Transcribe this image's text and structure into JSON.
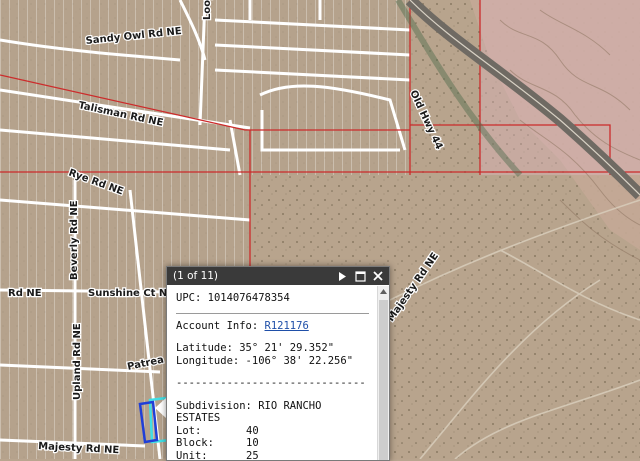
{
  "map": {
    "street_labels": [
      "Sandy Owl Rd NE",
      "Talisman Rd NE",
      "Rye Rd NE",
      "Beverly Rd NE",
      "Rd NE",
      "Sunshine Ct NE",
      "Upland Rd NE",
      "Patrea",
      "Majesty Rd NE",
      "Majesty Rd NE",
      "Old Hwy 44",
      "Loop Rd NE"
    ],
    "colors": {
      "imagery": "#b9a58f",
      "parcel_lines": "#ffffff",
      "district_lines": "#cc2b2b",
      "highway": "#6f6a63",
      "selected_parcel": "#1f3fd8",
      "highlight": "#3fe0e6"
    }
  },
  "popup": {
    "pager": "(1 of 11)",
    "next_icon": "play-icon",
    "maximize_icon": "maximize-icon",
    "close_icon": "close-icon",
    "upc_label": "UPC:",
    "upc_value": "1014076478354",
    "account_label": "Account Info:",
    "account_value": "R121176",
    "latitude_label": "Latitude:",
    "latitude_value": "35° 21' 29.352\"",
    "longitude_label": "Longitude:",
    "longitude_value": "-106° 38' 22.256\"",
    "divider_text": "------------------------------",
    "subdivision_label": "Subdivision:",
    "subdivision_value": "RIO RANCHO ESTATES",
    "lot_label": "Lot:",
    "lot_value": "40",
    "block_label": "Block:",
    "block_value": "10",
    "unit_label": "Unit:",
    "unit_value": "25"
  }
}
